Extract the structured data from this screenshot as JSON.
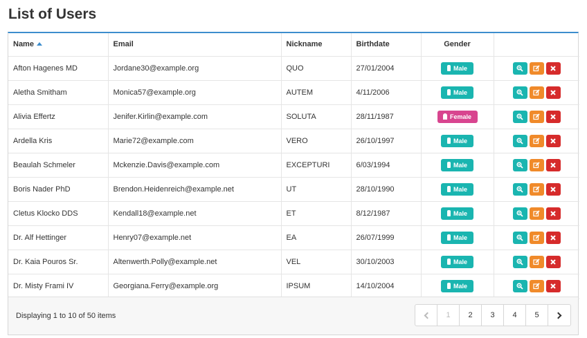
{
  "page_title": "List of Users",
  "columns": {
    "name": "Name",
    "email": "Email",
    "nickname": "Nickname",
    "birthdate": "Birthdate",
    "gender": "Gender"
  },
  "rows": [
    {
      "name": "Afton Hagenes MD",
      "email": "Jordane30@example.org",
      "nickname": "QUO",
      "birthdate": "27/01/2004",
      "gender": "Male"
    },
    {
      "name": "Aletha Smitham",
      "email": "Monica57@example.org",
      "nickname": "AUTEM",
      "birthdate": "4/11/2006",
      "gender": "Male"
    },
    {
      "name": "Alivia Effertz",
      "email": "Jenifer.Kirlin@example.com",
      "nickname": "SOLUTA",
      "birthdate": "28/11/1987",
      "gender": "Female"
    },
    {
      "name": "Ardella Kris",
      "email": "Marie72@example.com",
      "nickname": "VERO",
      "birthdate": "26/10/1997",
      "gender": "Male"
    },
    {
      "name": "Beaulah Schmeler",
      "email": "Mckenzie.Davis@example.com",
      "nickname": "EXCEPTURI",
      "birthdate": "6/03/1994",
      "gender": "Male"
    },
    {
      "name": "Boris Nader PhD",
      "email": "Brendon.Heidenreich@example.net",
      "nickname": "UT",
      "birthdate": "28/10/1990",
      "gender": "Male"
    },
    {
      "name": "Cletus Klocko DDS",
      "email": "Kendall18@example.net",
      "nickname": "ET",
      "birthdate": "8/12/1987",
      "gender": "Male"
    },
    {
      "name": "Dr. Alf Hettinger",
      "email": "Henry07@example.net",
      "nickname": "EA",
      "birthdate": "26/07/1999",
      "gender": "Male"
    },
    {
      "name": "Dr. Kaia Pouros Sr.",
      "email": "Altenwerth.Polly@example.net",
      "nickname": "VEL",
      "birthdate": "30/10/2003",
      "gender": "Male"
    },
    {
      "name": "Dr. Misty Frami IV",
      "email": "Georgiana.Ferry@example.org",
      "nickname": "IPSUM",
      "birthdate": "14/10/2004",
      "gender": "Male"
    }
  ],
  "footer_text": "Displaying 1 to 10 of 50 items",
  "pagination": {
    "pages": [
      "1",
      "2",
      "3",
      "4",
      "5"
    ],
    "current": "1"
  },
  "colors": {
    "accent": "#3c8dcd",
    "male": "#1ab5b0",
    "female": "#d8458f",
    "view": "#1ab5b0",
    "edit": "#f08a2a",
    "delete": "#d62b2b"
  },
  "icons": {
    "sort": "sort-ascending-icon",
    "male": "male-icon",
    "female": "female-icon",
    "view": "zoom-icon",
    "edit": "edit-icon",
    "delete": "delete-icon",
    "prev": "chevron-left-icon",
    "next": "chevron-right-icon"
  }
}
